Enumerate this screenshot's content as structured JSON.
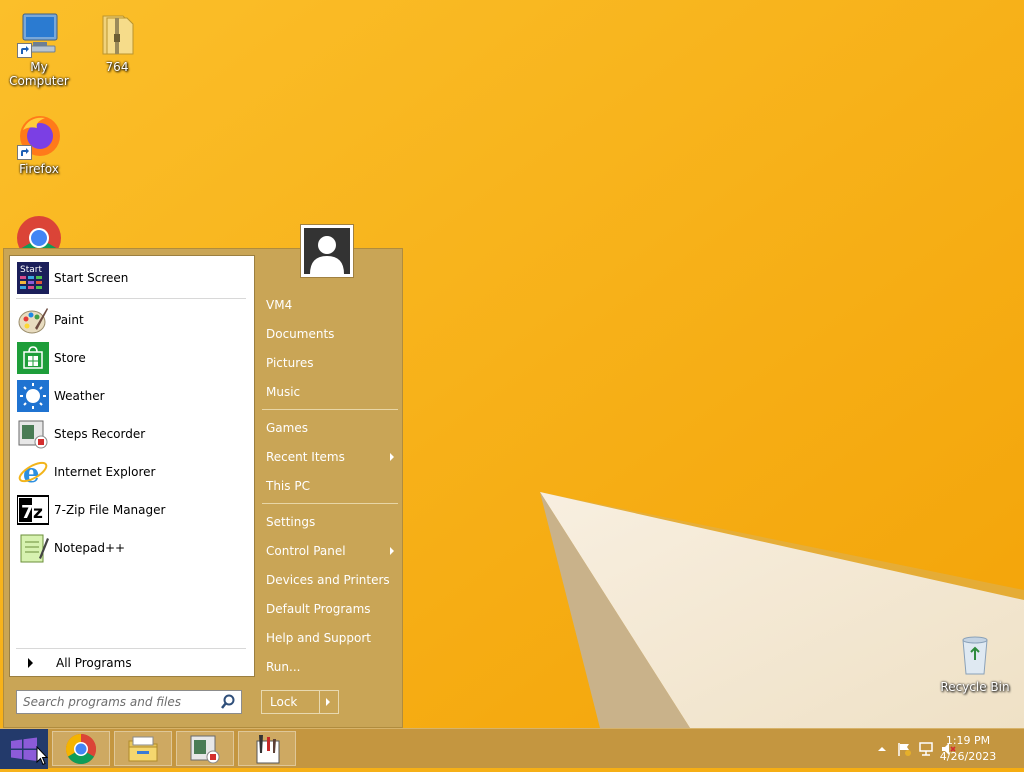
{
  "desktop": {
    "icons": [
      {
        "label": "My Computer"
      },
      {
        "label": "764"
      },
      {
        "label": "Firefox"
      },
      {
        "label": "Recycle Bin"
      }
    ]
  },
  "start_menu": {
    "programs": [
      {
        "label": "Start Screen",
        "icon": "start-screen-icon"
      },
      {
        "label": "Paint",
        "icon": "paint-icon"
      },
      {
        "label": "Store",
        "icon": "store-icon"
      },
      {
        "label": "Weather",
        "icon": "weather-icon"
      },
      {
        "label": "Steps Recorder",
        "icon": "steps-recorder-icon"
      },
      {
        "label": "Internet Explorer",
        "icon": "internet-explorer-icon"
      },
      {
        "label": "7-Zip File Manager",
        "icon": "7zip-icon"
      },
      {
        "label": "Notepad++",
        "icon": "notepad-plus-plus-icon"
      }
    ],
    "start_tile_text": "Start",
    "all_programs": "All Programs",
    "search_placeholder": "Search programs and files",
    "right_items": [
      {
        "label": "VM4"
      },
      {
        "label": "Documents"
      },
      {
        "label": "Pictures"
      },
      {
        "label": "Music"
      },
      {
        "label": "Games"
      },
      {
        "label": "Recent Items",
        "submenu": true
      },
      {
        "label": "This PC"
      },
      {
        "label": "Settings"
      },
      {
        "label": "Control Panel",
        "submenu": true
      },
      {
        "label": "Devices and Printers"
      },
      {
        "label": "Default Programs"
      },
      {
        "label": "Help and Support"
      },
      {
        "label": "Run..."
      }
    ],
    "lock_label": "Lock"
  },
  "taskbar": {
    "pinned": [
      "chrome-icon",
      "file-explorer-icon",
      "steps-recorder-icon",
      "paint-tool-icon"
    ],
    "clock_time": "1:19 PM",
    "clock_date": "4/26/2023"
  },
  "colors": {
    "wallpaper": "#f5ab0d",
    "menu_bg": "#c9a556",
    "taskbar_bg": "#c49640"
  }
}
